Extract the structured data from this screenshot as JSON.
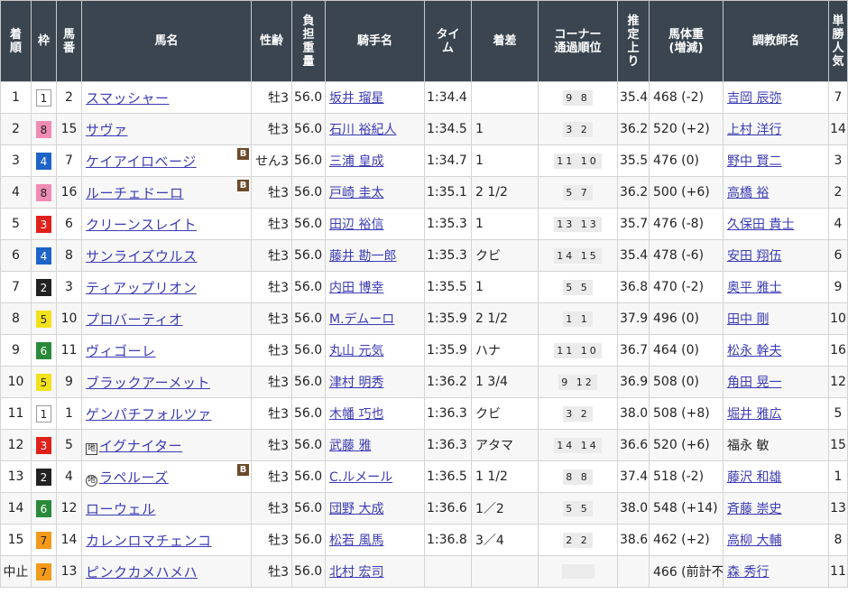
{
  "headers": [
    "着順",
    "枠",
    "馬番",
    "馬名",
    "性齢",
    "負担重量",
    "騎手名",
    "タイム",
    "着差",
    "コーナー通過順位",
    "推定上り",
    "馬体重(増減)",
    "調教師名",
    "単勝人気"
  ],
  "rows": [
    {
      "rank": "1",
      "waku": "1",
      "num": "2",
      "name": "スマッシャー",
      "blinker": false,
      "mark": "",
      "sex": "牡3",
      "weight": "56.0",
      "jockey": "坂井 瑠星",
      "time": "1:34.4",
      "margin": "",
      "corner": "9 8",
      "last": "35.4",
      "bw": "468 (-2)",
      "trainer": "吉岡 辰弥",
      "trainer_link": true,
      "pop": "7"
    },
    {
      "rank": "2",
      "waku": "8",
      "num": "15",
      "name": "サヴァ",
      "blinker": false,
      "mark": "",
      "sex": "牡3",
      "weight": "56.0",
      "jockey": "石川 裕紀人",
      "time": "1:34.5",
      "margin": "1",
      "corner": "3 2",
      "last": "36.2",
      "bw": "520 (+2)",
      "trainer": "上村 洋行",
      "trainer_link": true,
      "pop": "14"
    },
    {
      "rank": "3",
      "waku": "4",
      "num": "7",
      "name": "ケイアイロベージ",
      "blinker": true,
      "mark": "",
      "sex": "せん3",
      "weight": "56.0",
      "jockey": "三浦 皇成",
      "time": "1:34.7",
      "margin": "1",
      "corner": "11 10",
      "last": "35.5",
      "bw": "476 (0)",
      "trainer": "野中 賢二",
      "trainer_link": true,
      "pop": "3"
    },
    {
      "rank": "4",
      "waku": "8",
      "num": "16",
      "name": "ルーチェドーロ",
      "blinker": true,
      "mark": "",
      "sex": "牡3",
      "weight": "56.0",
      "jockey": "戸崎 圭太",
      "time": "1:35.1",
      "margin": "2 1/2",
      "corner": "5 7",
      "last": "36.2",
      "bw": "500 (+6)",
      "trainer": "高橋 裕",
      "trainer_link": true,
      "pop": "2"
    },
    {
      "rank": "5",
      "waku": "3",
      "num": "6",
      "name": "クリーンスレイト",
      "blinker": false,
      "mark": "",
      "sex": "牡3",
      "weight": "56.0",
      "jockey": "田辺 裕信",
      "time": "1:35.3",
      "margin": "1",
      "corner": "13 13",
      "last": "35.7",
      "bw": "476 (-8)",
      "trainer": "久保田 貴士",
      "trainer_link": true,
      "pop": "4"
    },
    {
      "rank": "6",
      "waku": "4",
      "num": "8",
      "name": "サンライズウルス",
      "blinker": false,
      "mark": "",
      "sex": "牡3",
      "weight": "56.0",
      "jockey": "藤井 勘一郎",
      "time": "1:35.3",
      "margin": "クビ",
      "corner": "14 15",
      "last": "35.4",
      "bw": "478 (-6)",
      "trainer": "安田 翔伍",
      "trainer_link": true,
      "pop": "6"
    },
    {
      "rank": "7",
      "waku": "2",
      "num": "3",
      "name": "ティアップリオン",
      "blinker": false,
      "mark": "",
      "sex": "牡3",
      "weight": "56.0",
      "jockey": "内田 博幸",
      "time": "1:35.5",
      "margin": "1",
      "corner": "5 5",
      "last": "36.8",
      "bw": "470 (-2)",
      "trainer": "奥平 雅士",
      "trainer_link": true,
      "pop": "9"
    },
    {
      "rank": "8",
      "waku": "5",
      "num": "10",
      "name": "プロバーティオ",
      "blinker": false,
      "mark": "",
      "sex": "牡3",
      "weight": "56.0",
      "jockey": "M.デムーロ",
      "time": "1:35.9",
      "margin": "2 1/2",
      "corner": "1 1",
      "last": "37.9",
      "bw": "496 (0)",
      "trainer": "田中 剛",
      "trainer_link": true,
      "pop": "10"
    },
    {
      "rank": "9",
      "waku": "6",
      "num": "11",
      "name": "ヴィゴーレ",
      "blinker": false,
      "mark": "",
      "sex": "牡3",
      "weight": "56.0",
      "jockey": "丸山 元気",
      "time": "1:35.9",
      "margin": "ハナ",
      "corner": "11 10",
      "last": "36.7",
      "bw": "464 (0)",
      "trainer": "松永 幹夫",
      "trainer_link": true,
      "pop": "16"
    },
    {
      "rank": "10",
      "waku": "5",
      "num": "9",
      "name": "ブラックアーメット",
      "blinker": false,
      "mark": "",
      "sex": "牡3",
      "weight": "56.0",
      "jockey": "津村 明秀",
      "time": "1:36.2",
      "margin": "1 3/4",
      "corner": "9 12",
      "last": "36.9",
      "bw": "508 (0)",
      "trainer": "角田 晃一",
      "trainer_link": true,
      "pop": "12"
    },
    {
      "rank": "11",
      "waku": "1",
      "num": "1",
      "name": "ゲンパチフォルツァ",
      "blinker": false,
      "mark": "",
      "sex": "牡3",
      "weight": "56.0",
      "jockey": "木幡 巧也",
      "time": "1:36.3",
      "margin": "クビ",
      "corner": "3 2",
      "last": "38.0",
      "bw": "508 (+8)",
      "trainer": "堀井 雅広",
      "trainer_link": true,
      "pop": "5"
    },
    {
      "rank": "12",
      "waku": "3",
      "num": "5",
      "name": "イグナイター",
      "blinker": false,
      "mark": "地",
      "sex": "牡3",
      "weight": "56.0",
      "jockey": "武藤 雅",
      "time": "1:36.3",
      "margin": "アタマ",
      "corner": "14 14",
      "last": "36.6",
      "bw": "520 (+6)",
      "trainer": "福永 敏",
      "trainer_link": false,
      "pop": "15"
    },
    {
      "rank": "13",
      "waku": "2",
      "num": "4",
      "name": "ラペルーズ",
      "blinker": true,
      "mark": "地",
      "sex": "牡3",
      "weight": "56.0",
      "jockey": "C.ルメール",
      "time": "1:36.5",
      "margin": "1 1/2",
      "corner": "8 8",
      "last": "37.4",
      "bw": "518 (-2)",
      "trainer": "藤沢 和雄",
      "trainer_link": true,
      "pop": "1"
    },
    {
      "rank": "14",
      "waku": "6",
      "num": "12",
      "name": "ローウェル",
      "blinker": false,
      "mark": "",
      "sex": "牡3",
      "weight": "56.0",
      "jockey": "団野 大成",
      "time": "1:36.6",
      "margin": "1／2",
      "corner": "5 5",
      "last": "38.0",
      "bw": "548 (+14)",
      "trainer": "斉藤 崇史",
      "trainer_link": true,
      "pop": "13"
    },
    {
      "rank": "15",
      "waku": "7",
      "num": "14",
      "name": "カレンロマチェンコ",
      "blinker": false,
      "mark": "",
      "sex": "牡3",
      "weight": "56.0",
      "jockey": "松若 風馬",
      "time": "1:36.8",
      "margin": "3／4",
      "corner": "2 2",
      "last": "38.6",
      "bw": "462 (+2)",
      "trainer": "高柳 大輔",
      "trainer_link": true,
      "pop": "8"
    },
    {
      "rank": "中止",
      "waku": "7",
      "num": "13",
      "name": "ピンクカメハメハ",
      "blinker": false,
      "mark": "",
      "sex": "牡3",
      "weight": "56.0",
      "jockey": "北村 宏司",
      "time": "",
      "margin": "",
      "corner": "",
      "last": "",
      "bw": "466 (前計不)",
      "trainer": "森 秀行",
      "trainer_link": true,
      "pop": "11"
    }
  ],
  "blinker_label": "B",
  "waku_colors": {
    "1": {
      "bg": "#ffffff",
      "fg": "#222222"
    },
    "2": {
      "bg": "#222222",
      "fg": "#ffffff"
    },
    "3": {
      "bg": "#e0201a",
      "fg": "#ffffff"
    },
    "4": {
      "bg": "#1e64c8",
      "fg": "#ffffff"
    },
    "5": {
      "bg": "#f2e21c",
      "fg": "#222222"
    },
    "6": {
      "bg": "#2a8a3a",
      "fg": "#ffffff"
    },
    "7": {
      "bg": "#f39a1a",
      "fg": "#222222"
    },
    "8": {
      "bg": "#f08cb4",
      "fg": "#222222"
    }
  }
}
